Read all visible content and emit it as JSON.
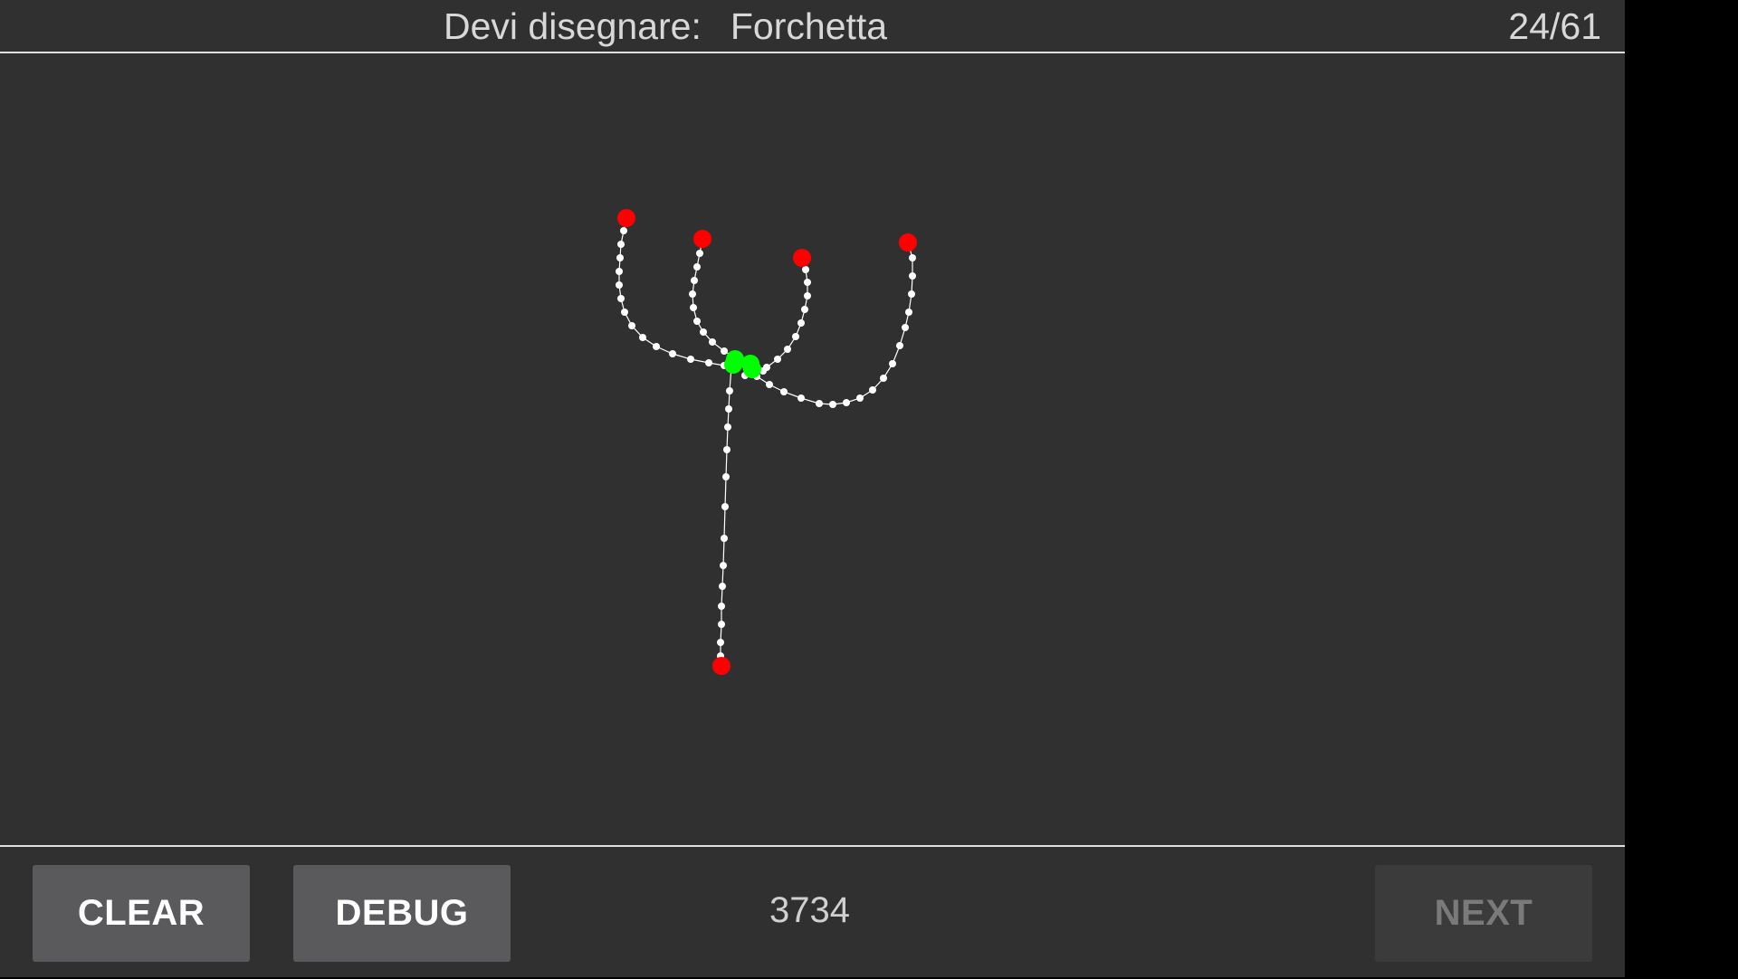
{
  "header": {
    "prompt_label": "Devi disegnare:",
    "target_word": "Forchetta",
    "progress": "24/61"
  },
  "footer": {
    "clear_label": "CLEAR",
    "debug_label": "DEBUG",
    "score": "3734",
    "next_label": "NEXT",
    "next_enabled": false
  },
  "colors": {
    "background": "#303030",
    "stroke": "#ffffff",
    "endpoint": "#ff0000",
    "junction": "#00ff00"
  }
}
